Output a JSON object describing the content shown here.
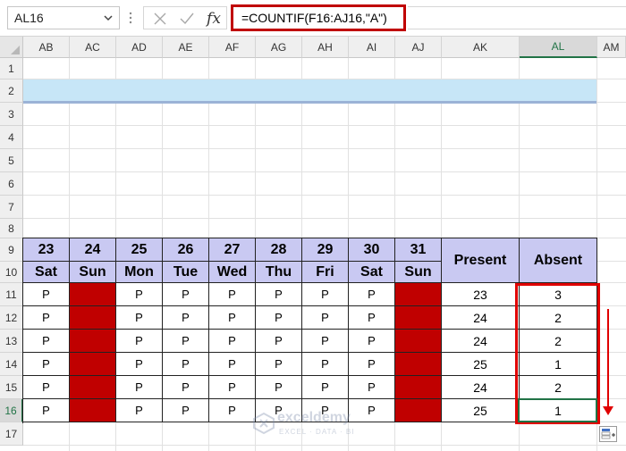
{
  "formula_bar": {
    "name_box": "AL16",
    "cancel_icon": "close-icon",
    "enter_icon": "check-icon",
    "fx_label": "fx",
    "formula": "=COUNTIF(F16:AJ16,\"A\")"
  },
  "columns": [
    "AB",
    "AC",
    "AD",
    "AE",
    "AF",
    "AG",
    "AH",
    "AI",
    "AJ",
    "AK",
    "AL",
    "AM"
  ],
  "selected_column": "AL",
  "rows": [
    "1",
    "2",
    "3",
    "4",
    "5",
    "6",
    "7",
    "8",
    "9",
    "10",
    "11",
    "12",
    "13",
    "14",
    "15",
    "16",
    "17"
  ],
  "selected_row": "16",
  "table": {
    "dates": [
      "23",
      "24",
      "25",
      "26",
      "27",
      "28",
      "29",
      "30",
      "31"
    ],
    "days": [
      "Sat",
      "Sun",
      "Mon",
      "Tue",
      "Wed",
      "Thu",
      "Fri",
      "Sat",
      "Sun"
    ],
    "present_header": "Present",
    "absent_header": "Absent",
    "attendance_mark": "P",
    "holiday_color": "#c00000",
    "header_color": "#c9c9f2",
    "present_values": [
      "23",
      "24",
      "24",
      "25",
      "24",
      "25"
    ],
    "absent_values": [
      "3",
      "2",
      "2",
      "1",
      "2",
      "1"
    ]
  },
  "banner_color": "#c7e6f7",
  "highlight_color": "#e00000",
  "watermark": {
    "name": "exceldemy",
    "tagline": "EXCEL · DATA · BI"
  }
}
